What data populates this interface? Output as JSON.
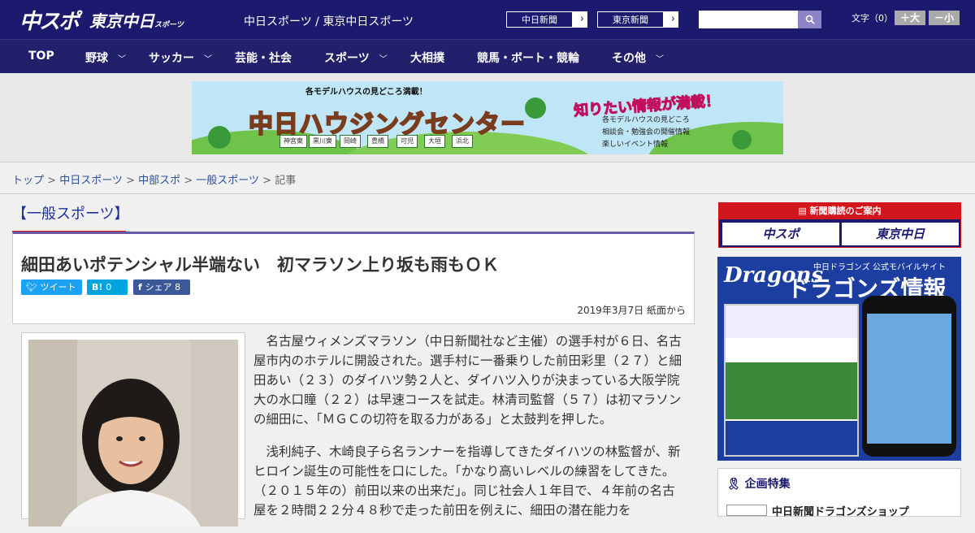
{
  "header": {
    "logo_chuspo": "中スポ",
    "logo_tokyo": "東京中日",
    "logo_tokyo_small": "スポーツ",
    "site_names": "中日スポーツ / 東京中日スポーツ",
    "btn_chunichi": "中日新聞",
    "btn_tokyo": "東京新聞",
    "search_icon": "search-icon",
    "font_label": "文字（0）",
    "font_plus": "＋大",
    "font_minus": "－小"
  },
  "nav": {
    "items": [
      "TOP",
      "野球",
      "サッカー",
      "芸能・社会",
      "スポーツ",
      "大相撲",
      "競馬・ボート・競輪",
      "その他"
    ]
  },
  "banner": {
    "top_text": "各モデルハウスの見どころ満載！",
    "main_text": "中日ハウジングセンター",
    "sub_text": "知りたい情報が満載！",
    "features": [
      "各モデルハウスの見どころ",
      "相談会・勉強会の開催情報",
      "楽しいイベント情報"
    ],
    "towns": [
      "神宮東",
      "黒川東",
      "岡崎",
      "豊橋",
      "可児",
      "大垣",
      "浜北"
    ]
  },
  "breadcrumb": {
    "items": [
      "トップ",
      "中日スポーツ",
      "中部スポ",
      "一般スポーツ"
    ],
    "current": "記事",
    "sep": " > "
  },
  "article": {
    "category": "【一般スポーツ】",
    "title": "細田あいポテンシャル半端ない　初マラソン上り坂も雨もＯＫ",
    "tweet": "ツイート",
    "hatena_count": "0",
    "share_label": "シェア",
    "share_count": "8",
    "date": "2019年3月7日 紙面から",
    "paragraphs": [
      "名古屋ウィメンズマラソン（中日新聞社など主催）の選手村が６日、名古屋市内のホテルに開設された。選手村に一番乗りした前田彩里（２７）と細田あい（２３）のダイハツ勢２人と、ダイハツ入りが決まっている大阪学院大の水口瞳（２２）は早速コースを試走。林清司監督（５７）は初マラソンの細田に、「ＭＧＣの切符を取る力がある」と太鼓判を押した。",
      "浅利純子、木崎良子ら名ランナーを指導してきたダイハツの林監督が、新ヒロイン誕生の可能性を口にした。「かなり高いレベルの練習をしてきた。（２０１５年の）前田以来の出来だ」。同じ社会人１年目で、４年前の名古屋を２時間２２分４８秒で走った前田を例えに、細田の潜在能力を"
    ]
  },
  "sidebar": {
    "subscribe_head": "新聞購読のご案内",
    "sub_chuspo": "中スポ",
    "sub_tokyo": "東京中日",
    "dragons_logo": "Dragons",
    "dragons_tag": "中日ドラゴンズ 公式モバイルサイト",
    "dragons_title": "ドラゴンズ情報",
    "tokushu": "企画特集",
    "tokushu_item": "中日新聞ドラゴンズショップ"
  }
}
